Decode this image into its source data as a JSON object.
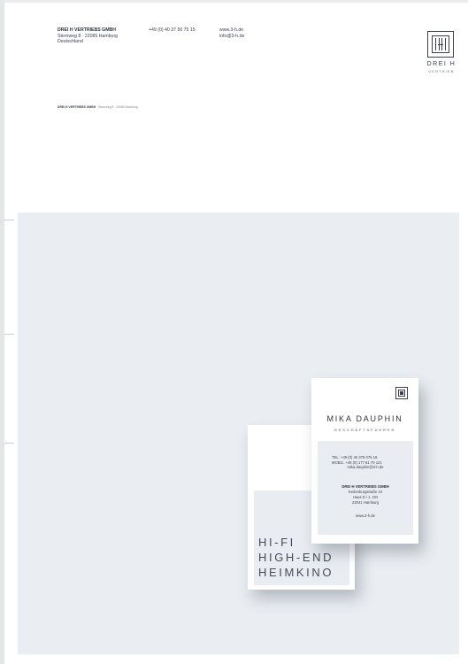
{
  "letterhead": {
    "company_name": "DREI H VERTRIEBS GMBH",
    "address_street": "Sternweg 8 · 22085 Hamburg",
    "address_country": "Deutschland",
    "phone": "+49 (0) 40 37 50 75 15",
    "web": "www.3-h.de",
    "email": "info@3-h.de",
    "logo_name": "DREI H",
    "logo_sub": "VERTRIEB",
    "sender_company": "DREI H VERTRIEBS GMBH",
    "sender_address": " · Sternweg 8 · 22085 Hamburg"
  },
  "card_back": {
    "slogan_1": "HI-FI",
    "slogan_2": "HIGH-END",
    "slogan_3": "HEIMKINO"
  },
  "card_front": {
    "name": "MIKA DAUPHIN",
    "title": "GESCHÄFTSFÜHRER",
    "tel": "TEL:     +49 (0) 40 375 075 15",
    "mobil": "MOBIL:  +49 (0) 177 61 70 121",
    "email": "mika.dauphin@3-h.de",
    "company": "DREI H VERTRIEBS GMBH",
    "street": "Kedenburgstraße 44",
    "building": "Haus D / 1. OG",
    "city": "22041 Hamburg",
    "web": "www.3-h.de"
  },
  "colors": {
    "panel": "#eaeef2",
    "ink": "#3b4150"
  }
}
